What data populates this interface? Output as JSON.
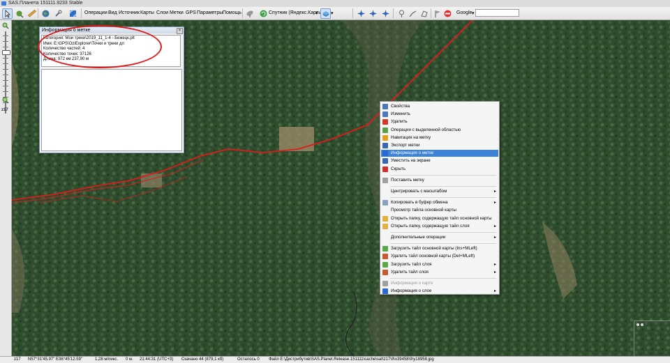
{
  "window": {
    "title": "SAS.Планета 151111.9233 Stable"
  },
  "menu": [
    "Операции",
    "Вид",
    "Источник",
    "Карты",
    "Слои",
    "Метки",
    "GPS",
    "Параметры",
    "Помощь"
  ],
  "map_source": "Спутник (Яндекс.Карты)",
  "search_provider": "Google",
  "zoom_label": "z17",
  "info_window": {
    "title": "Информация о метке",
    "close_glyph": "×",
    "lines": [
      "Категория: Мои треки\\2019_11_1-4 - Бежецк.plt",
      "Имя: E:\\GPS\\OziExplorer\\Точки и треки дл",
      "Количество частей: 4",
      "Количество точек: 37126",
      "Длина: 972 км 237,90 м"
    ]
  },
  "context_menu": [
    {
      "label": "Свойства",
      "icon_color": "#4a78b8"
    },
    {
      "label": "Изменить",
      "icon_color": "#4a78b8"
    },
    {
      "label": "Удалить",
      "icon_color": "#d23a2a"
    },
    {
      "label": "Операции с выделенной областью",
      "icon_color": "#5aa04a"
    },
    {
      "label": "Навигация на метку",
      "icon_color": "#e0a020"
    },
    {
      "label": "Экспорт метки",
      "icon_color": "#3a68b0"
    },
    {
      "label": "Информация о метке",
      "icon_color": "#2a6ad0",
      "highlighted": true
    },
    {
      "label": "Уместить на экране",
      "icon_color": "#3a68b0"
    },
    {
      "label": "Скрыть",
      "icon_color": "#d03030"
    },
    {
      "separator": true
    },
    {
      "label": "Поставить метку",
      "icon_color": "#a0a0a0"
    },
    {
      "separator": true
    },
    {
      "label": "Центрировать с масштабом",
      "submenu": true
    },
    {
      "separator": true
    },
    {
      "label": "Копировать в буфер обмена",
      "icon_color": "#8aa0c0",
      "submenu": true
    },
    {
      "label": "Просмотр тайла основной карты"
    },
    {
      "label": "Открыть папку, содержащую тайл основной карты",
      "icon_color": "#e2b040"
    },
    {
      "label": "Открыть папку, содержащую тайл слоя",
      "icon_color": "#e2b040",
      "submenu": true
    },
    {
      "separator": true
    },
    {
      "label": "Дополнительные операции",
      "submenu": true
    },
    {
      "separator": true
    },
    {
      "label": "Загрузить тайл основной карты (Ins+MLeft)",
      "icon_color": "#58a848"
    },
    {
      "label": "Удалить тайл основной карты (Del+MLeft)",
      "icon_color": "#c85a30"
    },
    {
      "label": "Загрузить тайл слоя",
      "icon_color": "#58a848",
      "submenu": true
    },
    {
      "label": "Удалить тайл слоя",
      "icon_color": "#c85a30",
      "submenu": true
    },
    {
      "separator": true
    },
    {
      "label": "Информация о карте",
      "icon_color": "#a0a0a0",
      "disabled": true
    },
    {
      "label": "Информация о слое",
      "icon_color": "#2a6ad0",
      "submenu": true
    }
  ],
  "submenu_glyph": "▸",
  "status": {
    "zoom": "z17",
    "coords": "N57°31'45.97\" E36°45'12.59\"",
    "scale": "1,28 м/пикс.",
    "altitude": "0 м.",
    "time": "21:44:31 (UTC+3)",
    "downloaded": "Скачано 44 (879,1 кб)",
    "remaining": "Осталось 0",
    "file": "Файл E:\\Дистрибутив\\SAS.Planet.Release.151111\\cache\\sat\\z17\\9\\x39458\\9\\y18958.jpg"
  }
}
